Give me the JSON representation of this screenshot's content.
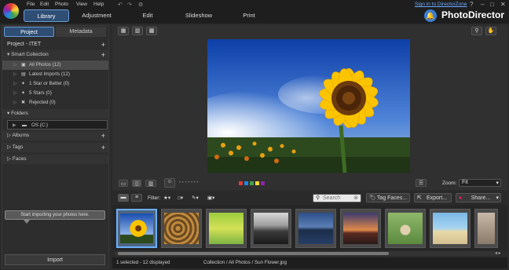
{
  "menu": [
    "File",
    "Edit",
    "Photo",
    "View",
    "Help"
  ],
  "modes": [
    "Library",
    "Adjustment",
    "Edit",
    "Slideshow",
    "Print"
  ],
  "signin": "Sign in to DirectorZone",
  "brand": "PhotoDirector",
  "panel_tabs": [
    "Project",
    "Metadata"
  ],
  "project_title": "Project - ITET",
  "smart_collection": "Smart Collection",
  "smart_items": [
    "All Photos (12)",
    "Latest Imports (12)",
    "1 Star or Better (0)",
    "5 Stars (0)",
    "Rejected (0)"
  ],
  "folders": "Folders",
  "folder_item": "OS (C:)",
  "albums": "Albums",
  "tags": "Tags",
  "faces": "Faces",
  "import_tip": "Start importing your photos here.",
  "import": "Import",
  "zoom_label": "Zoom:",
  "zoom_value": "Fit",
  "filter_label": "Filter:",
  "search_placeholder": "Search",
  "tag_faces": "Tag Faces...",
  "export": "Export...",
  "share": "Share...",
  "status_left": "1 selected - 12 displayed",
  "status_path": "Collection / All Photos / Sun Flower.jpg",
  "color_labels": [
    "#e53935",
    "#1e88e5",
    "#43a047",
    "#fdd835",
    "#8e24aa"
  ],
  "accent": "#2f4e74"
}
